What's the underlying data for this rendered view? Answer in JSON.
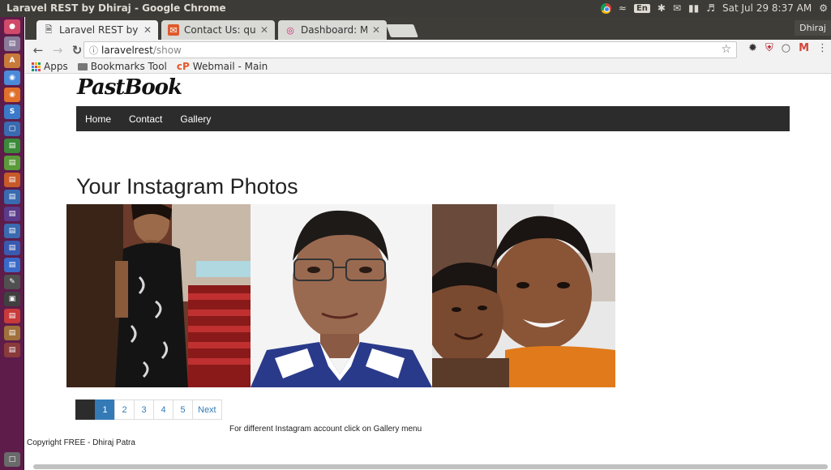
{
  "system_panel": {
    "window_title": "Laravel REST by Dhiraj - Google Chrome",
    "keyboard": "En",
    "clock": "Sat Jul 29  8:37 AM"
  },
  "browser": {
    "tabs": [
      {
        "label": "Laravel REST by Dh",
        "active": true,
        "icon": "page-icon"
      },
      {
        "label": "Contact Us: questic",
        "active": false,
        "icon": "mail-icon"
      },
      {
        "label": "Dashboard: Main - I",
        "active": false,
        "icon": "instagram-icon"
      }
    ],
    "profile_name": "Dhiraj",
    "address": {
      "host": "laravelrest",
      "path": "/show"
    },
    "bookmarks": [
      {
        "label": "Apps",
        "icon": "apps-grid-icon"
      },
      {
        "label": "Bookmarks Tool",
        "icon": "folder-icon"
      },
      {
        "label": "Webmail - Main",
        "icon": "cpanel-icon"
      }
    ]
  },
  "site": {
    "logo": "PastBook",
    "nav": [
      "Home",
      "Contact",
      "Gallery"
    ],
    "heading": "Your Instagram Photos",
    "pagination": {
      "pages": [
        "1",
        "2",
        "3",
        "4",
        "5"
      ],
      "current": "1",
      "next": "Next"
    },
    "footnote": "For different Instagram account click on Gallery menu",
    "copyright": "Copyright FREE - Dhiraj Patra"
  },
  "colors": {
    "launcher": "#5e1c4a",
    "navbar": "#2c2c2c",
    "link": "#337ab7"
  }
}
